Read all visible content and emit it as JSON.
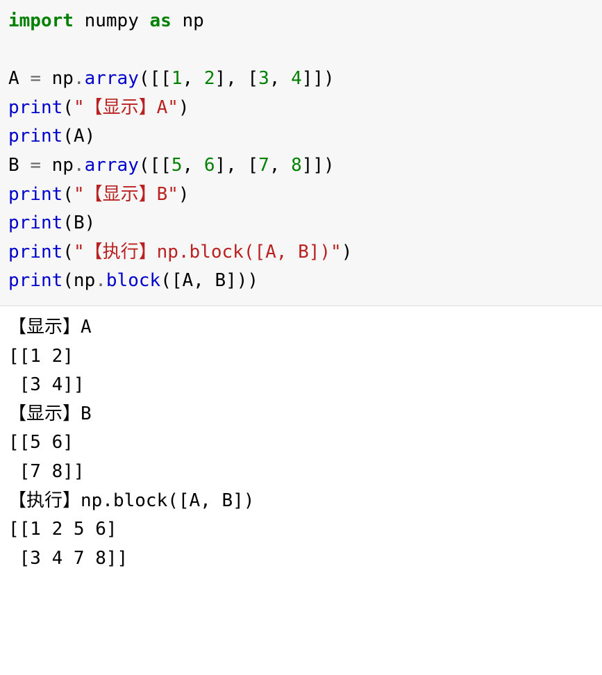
{
  "code": {
    "l1": {
      "kw1": "import",
      "mod": " numpy ",
      "kw2": "as",
      "alias": " np"
    },
    "l3": {
      "var": "A ",
      "op": "=",
      "pre": " np",
      "dot": ".",
      "fn": "array",
      "open": "([[",
      "n1": "1",
      "c1": ", ",
      "n2": "2",
      "mid": "], [",
      "n3": "3",
      "c2": ", ",
      "n4": "4",
      "close": "]])"
    },
    "l4": {
      "fn": "print",
      "open": "(",
      "str": "\"【显示】A\"",
      "close": ")"
    },
    "l5": {
      "fn": "print",
      "open": "(",
      "arg": "A",
      "close": ")"
    },
    "l6": {
      "var": "B ",
      "op": "=",
      "pre": " np",
      "dot": ".",
      "fn": "array",
      "open": "([[",
      "n1": "5",
      "c1": ", ",
      "n2": "6",
      "mid": "], [",
      "n3": "7",
      "c2": ", ",
      "n4": "8",
      "close": "]])"
    },
    "l7": {
      "fn": "print",
      "open": "(",
      "str": "\"【显示】B\"",
      "close": ")"
    },
    "l8": {
      "fn": "print",
      "open": "(",
      "arg": "B",
      "close": ")"
    },
    "l9": {
      "fn": "print",
      "open": "(",
      "str": "\"【执行】np.block([A, B])\"",
      "close": ")"
    },
    "l10": {
      "fn": "print",
      "open": "(np",
      "dot": ".",
      "fn2": "block",
      "args": "([A, B]))"
    }
  },
  "output": {
    "l1": "【显示】A",
    "l2": "[[1 2]",
    "l3": " [3 4]]",
    "l4": "【显示】B",
    "l5": "[[5 6]",
    "l6": " [7 8]]",
    "l7": "【执行】np.block([A, B])",
    "l8": "[[1 2 5 6]",
    "l9": " [3 4 7 8]]"
  }
}
